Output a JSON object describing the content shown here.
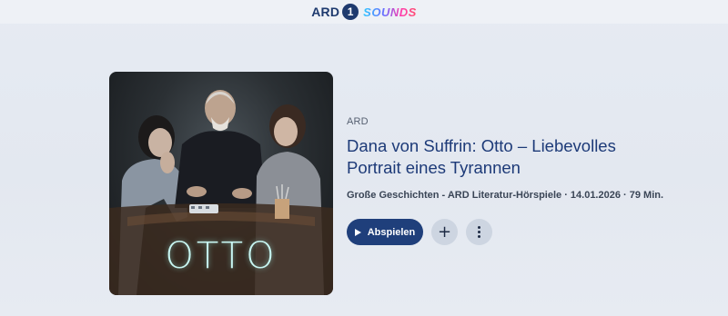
{
  "header": {
    "logo_ard": "ARD",
    "logo_one": "1",
    "logo_sounds": "SOUNDS"
  },
  "episode": {
    "cover_title": "OTTO",
    "publisher": "ARD",
    "title": "Dana von Suffrin: Otto – Liebevolles Portrait eines Tyrannen",
    "meta": "Große Geschichten - ARD Literatur-Hörspiele · 14.01.2026 · 79 Min."
  },
  "actions": {
    "play_label": "Abspielen",
    "add_icon": "plus-icon",
    "more_icon": "more-vertical-icon"
  },
  "colors": {
    "brand_blue": "#1f3f7b",
    "title_blue": "#1d3a78",
    "cover_text": "#c8f6f2"
  }
}
